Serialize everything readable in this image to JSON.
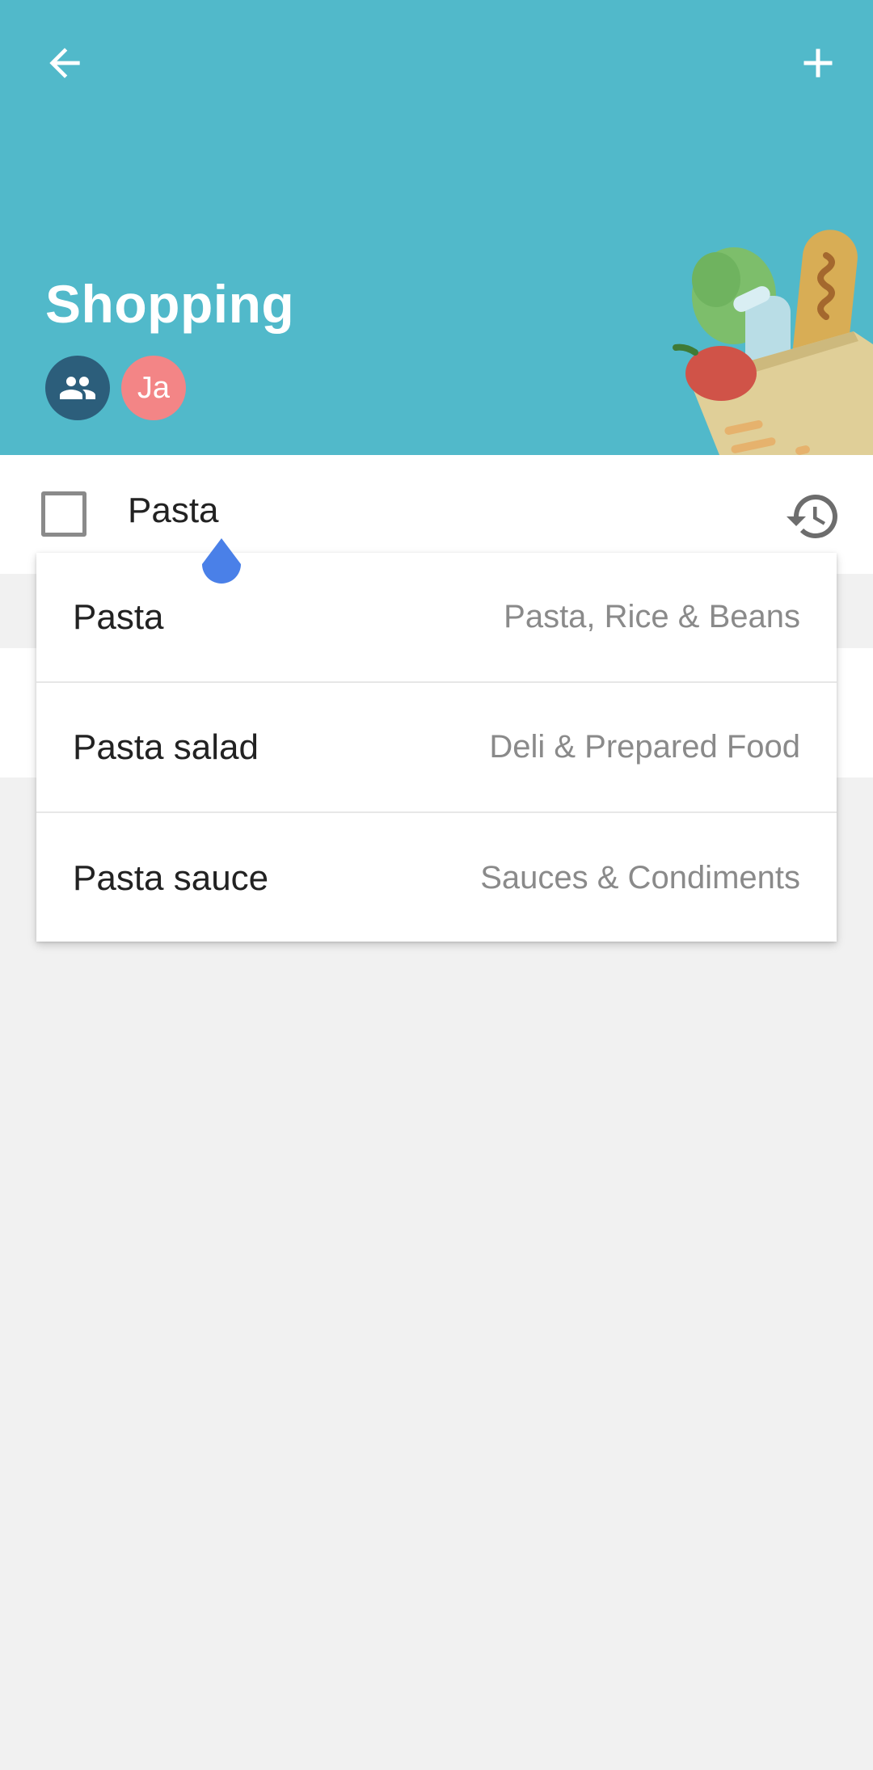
{
  "header": {
    "title": "Shopping",
    "back_icon": "arrow-back-icon",
    "add_icon": "plus-icon",
    "background_color": "#51b9ca",
    "members": {
      "group_icon": "people-icon",
      "avatar_initials": "Ja",
      "avatar_color": "#f38586"
    },
    "illustration": "grocery-bag-illustration"
  },
  "entry": {
    "value": "Pasta",
    "checkbox_checked": false,
    "history_icon": "history-icon"
  },
  "suggestions": [
    {
      "name": "Pasta",
      "category": "Pasta, Rice & Beans"
    },
    {
      "name": "Pasta salad",
      "category": "Deli & Prepared Food"
    },
    {
      "name": "Pasta sauce",
      "category": "Sauces & Condiments"
    }
  ],
  "colors": {
    "accent": "#51b9ca",
    "cursor": "#4a80e8",
    "text": "#222222",
    "secondary_text": "#8a8a8a"
  }
}
